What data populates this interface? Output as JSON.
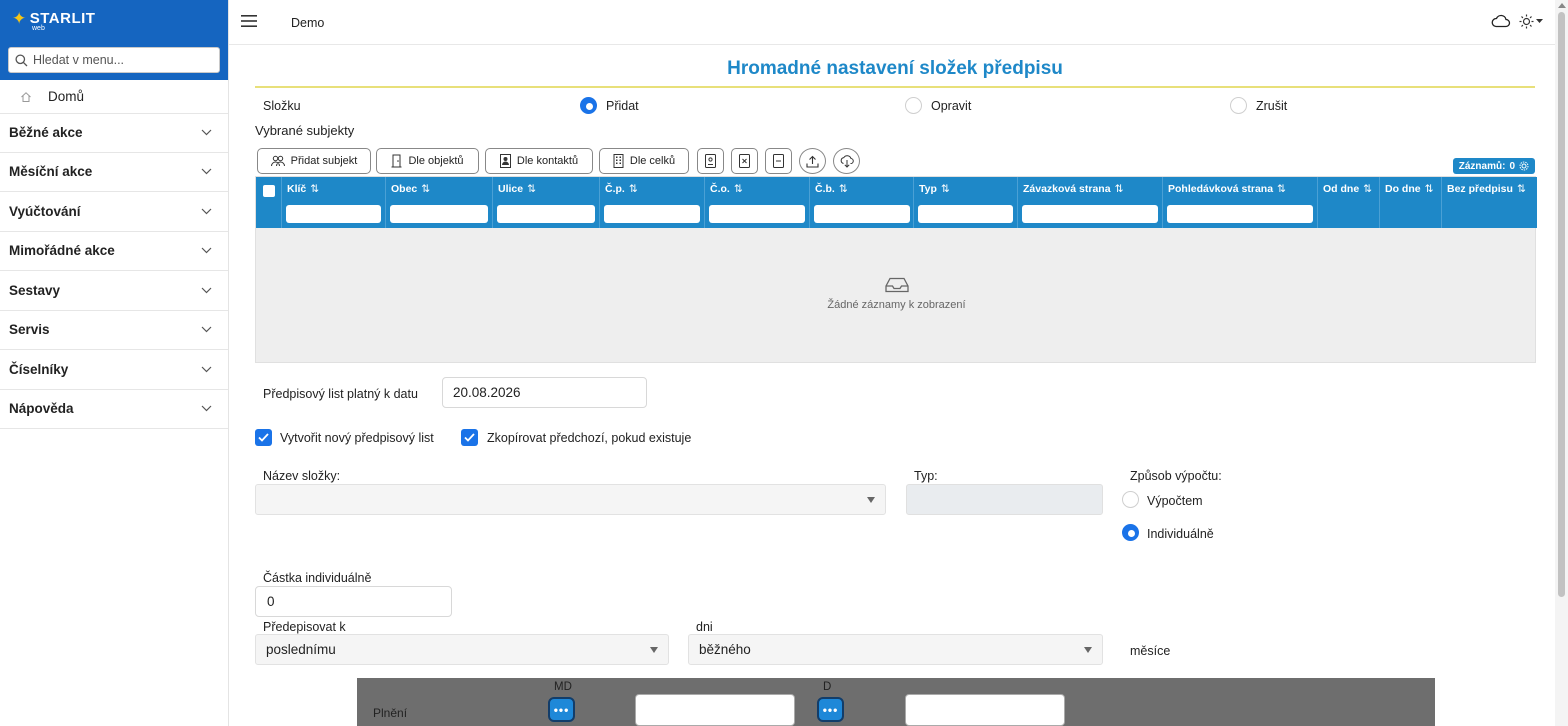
{
  "brand": {
    "name": "STARLIT",
    "sub": "web"
  },
  "menu_search": {
    "placeholder": "Hledat v menu..."
  },
  "sidebar": {
    "home": "Domů",
    "items": [
      {
        "label": "Běžné akce"
      },
      {
        "label": "Měsíční akce"
      },
      {
        "label": "Vyúčtování"
      },
      {
        "label": "Mimořádné akce"
      },
      {
        "label": "Sestavy"
      },
      {
        "label": "Servis"
      },
      {
        "label": "Číselníky"
      },
      {
        "label": "Nápověda"
      }
    ]
  },
  "topbar": {
    "title": "Demo"
  },
  "page": {
    "title": "Hromadné nastavení složek předpisu",
    "slozka_label": "Složku",
    "modes": [
      "Přidat",
      "Opravit",
      "Zrušit"
    ],
    "selected_mode": "Přidat",
    "subjects_title": "Vybrané subjekty"
  },
  "toolbar": {
    "add_subject": "Přidat subjekt",
    "by_objects": "Dle objektů",
    "by_contacts": "Dle kontaktů",
    "by_units": "Dle celků"
  },
  "records": {
    "label": "Záznamů:",
    "count": "0"
  },
  "grid": {
    "columns": [
      "Klíč",
      "Obec",
      "Ulice",
      "Č.p.",
      "Č.o.",
      "Č.b.",
      "Typ",
      "Závazková strana",
      "Pohledávková strana",
      "Od dne",
      "Do dne",
      "Bez předpisu"
    ],
    "empty_text": "Žádné záznamy k zobrazení"
  },
  "form": {
    "valid_date_label": "Předpisový list platný k datu",
    "valid_date_value": "20.08.2026",
    "create_new_label": "Vytvořit nový předpisový list",
    "create_new_checked": true,
    "copy_prev_label": "Zkopírovat předchozí, pokud existuje",
    "copy_prev_checked": true,
    "component_name_label": "Název složky:",
    "component_name_value": "",
    "type_label": "Typ:",
    "type_value": "",
    "calc_label": "Způsob výpočtu:",
    "calc_options": [
      "Výpočtem",
      "Individuálně"
    ],
    "calc_selected": "Individuálně",
    "amount_label": "Částka individuálně",
    "amount_value": "0",
    "prescribe_label": "Předepisovat k",
    "prescribe_value": "poslednímu",
    "days_label": "dni",
    "days_value": "běžného",
    "months_label": "měsíce"
  },
  "panel": {
    "row_label": "Plnění",
    "md_label": "MD",
    "d_label": "D",
    "dots": "•••"
  },
  "colors": {
    "brand": "#1565c0",
    "accent": "#1e88c8",
    "title_underline": "#e8e07a",
    "radio_on": "#1a73e8"
  }
}
